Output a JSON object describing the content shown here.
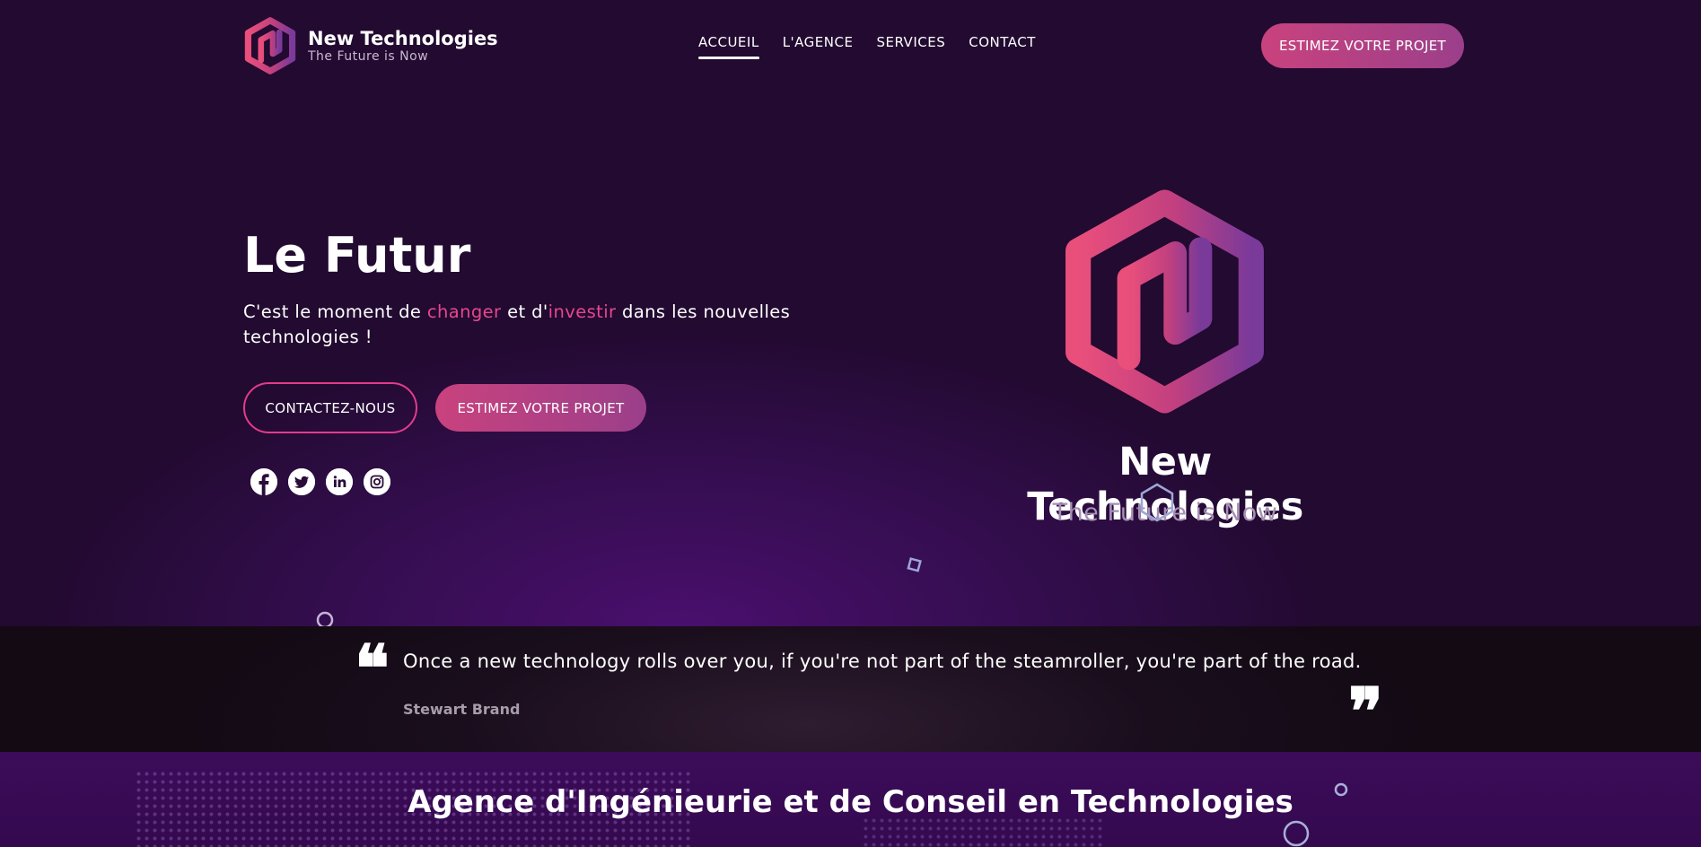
{
  "brand": {
    "name": "New Technologies",
    "tagline": "The Future is Now"
  },
  "nav": {
    "items": [
      "ACCUEIL",
      "L'AGENCE",
      "SERVICES",
      "CONTACT"
    ],
    "active": "ACCUEIL"
  },
  "header": {
    "cta_label": "ESTIMEZ VOTRE PROJET"
  },
  "hero": {
    "title": "Le Futur",
    "subtitle_parts": [
      "C'est le moment de ",
      "changer",
      " et d'",
      "investir",
      " dans les nouvelles technologies !"
    ],
    "contact_button": "CONTACTEZ-NOUS",
    "estimate_button": "ESTIMEZ VOTRE PROJET",
    "socials": [
      "facebook-icon",
      "twitter-icon",
      "linkedin-icon",
      "instagram-icon"
    ],
    "logo_name": "New Technologies",
    "logo_tagline": "The Future is Now"
  },
  "quote": {
    "text": "Once a new technology rolls over you, if you're not part of the steamroller, you're part of the road.",
    "author": "Stewart Brand",
    "open_mark": "❝",
    "close_mark": "❞"
  },
  "agency": {
    "title": "Agence d'Ingénieurie et de Conseil en Technologies"
  },
  "colors": {
    "accent_pink": "#e6478e",
    "accent_purple": "#9b3f8a",
    "background": "#220a2e",
    "quote_band": "#130a14"
  }
}
